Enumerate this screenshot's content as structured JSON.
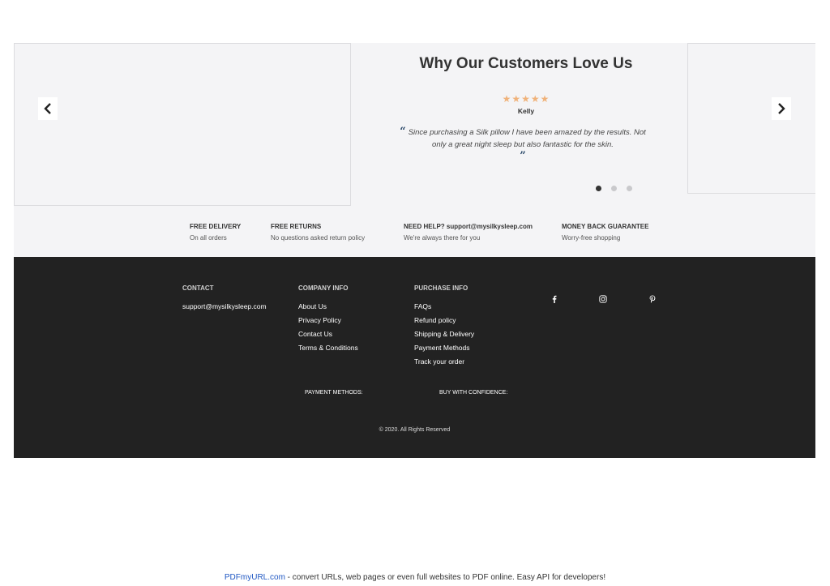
{
  "testimonials": {
    "title": "Why Our Customers Love Us",
    "rating_stars": "★★★★★",
    "reviewer": "Kelly",
    "quote_open": "“",
    "quote": "Since purchasing a Silk pillow I have been amazed by the results. Not only a great night sleep but also fantastic for the skin.",
    "quote_close": "”",
    "rating_color": "#f0b27a",
    "quote_mark_color": "#2c4a6b",
    "dots": [
      {
        "active": true
      },
      {
        "active": false
      },
      {
        "active": false
      }
    ]
  },
  "features": [
    {
      "title": "FREE DELIVERY",
      "sub": "On all orders"
    },
    {
      "title": "FREE RETURNS",
      "sub": "No questions asked return policy"
    },
    {
      "title": "NEED HELP? support@mysilkysleep.com",
      "sub": "We're always there for you"
    },
    {
      "title": "MONEY BACK GUARANTEE",
      "sub": "Worry-free shopping"
    }
  ],
  "footer": {
    "background_color": "#222222",
    "contact": {
      "heading": "CONTACT",
      "email": "support@mysilkysleep.com"
    },
    "company_info": {
      "heading": "COMPANY INFO",
      "links": [
        "About Us",
        "Privacy Policy",
        "Contact Us",
        "Terms & Conditions"
      ]
    },
    "purchase_info": {
      "heading": "PURCHASE INFO",
      "links": [
        "FAQs",
        "Refund policy",
        "Shipping & Delivery",
        "Payment Methods",
        "Track your order"
      ]
    },
    "social_icons": [
      "facebook-icon",
      "instagram-icon",
      "pinterest-icon"
    ],
    "payment_methods_label": "PAYMENT METHODS:",
    "buy_with_confidence_label": "BUY WITH CONFIDENCE:",
    "copyright": "© 2020. All Rights Reserved"
  },
  "pdf_banner": {
    "link_text": "PDFmyURL.com",
    "text": " - convert URLs, web pages or even full websites to PDF online. Easy API for developers!"
  }
}
